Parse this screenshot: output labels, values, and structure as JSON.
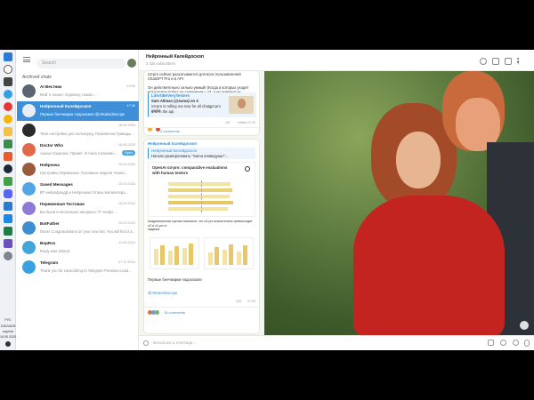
{
  "taskbar": {
    "lang": "РУС",
    "temp": "20&24&28",
    "weather": "отд/нов",
    "date": "16.06.2025"
  },
  "sidebar": {
    "search_placeholder": "Search",
    "archived_label": "Archived chats",
    "chats": [
      {
        "name": "AI Вестник",
        "preview": "Мой тг-канал: подписку, пожал...",
        "time": "19:50",
        "avatar_color": "#5b6470",
        "active": false
      },
      {
        "name": "Нейронный Калейдоскоп",
        "preview": "Первые бенчмарки подсказали @AIKaleidoscope",
        "time": "17:42",
        "avatar_color": "#e9eef5",
        "active": true
      },
      {
        "name": "",
        "preview": "Твоя настройка для полсекунд, Переменна Гравиды ...",
        "time": "16:05.2025",
        "avatar_color": "#2b2b2b",
        "active": false
      },
      {
        "name": "Doctor Who",
        "preview": "Ажоха Озерских: Привет. Я Анна Сенкевич...",
        "time": "16.05.2025",
        "avatar_color": "#e2684a",
        "active": false,
        "badge": "Open"
      },
      {
        "name": "Нейронка",
        "preview": "Настройка Перманэнх: Основные модели Чинни...",
        "time": "20.03.2025",
        "avatar_color": "#9a5a3e",
        "active": false
      },
      {
        "name": "Saved Messages",
        "preview": "ВТ-нейрофондД и Нейронная Этапы Кипалитера...",
        "time": "22.03.2025",
        "avatar_color": "#53a6e6",
        "active": false
      },
      {
        "name": "Переменная Тестовая",
        "preview": "Вы были в нескольких нисарных ТГ-нейро ...",
        "time": "15.03.2024",
        "avatar_color": "#8f7ad6",
        "active": false
      },
      {
        "name": "BotFather",
        "preview": "Done! Congratulations on your new bot. You will find it a...",
        "time": "19.03.2024",
        "avatar_color": "#3d8fd1",
        "active": false
      },
      {
        "name": "BopRss",
        "preview": "Reply was Visited",
        "time": "11.05.2024",
        "avatar_color": "#41a7da",
        "active": false
      },
      {
        "name": "Telegram",
        "preview": "Thank you for subscribing to Telegram Premium Lead...",
        "time": "07.12.2024",
        "avatar_color": "#3aa0e0",
        "active": false
      }
    ]
  },
  "header": {
    "title": "Нейронный Калейдоскоп",
    "subtitle": "2 325 subscribers"
  },
  "post1": {
    "lines": [
      "o3-pro сейчас раскатывается для всех пользователей",
      "ChatGPT Pro и в API",
      "",
      "Он действительно сильно умный! (Когда в которых уходят",
      "показатели побед на сравнении с o3, а не поверил их",
      "@AIKaleidoscope"
    ],
    "quote_title": "LilArtiBeVeryTesters",
    "quote_lines": [
      "Sam Altman (@sama) on X",
      "o3-pro is rolling out now for all chatgpt pro users",
      "and in the api."
    ],
    "views": "167",
    "time": "edited 17:22",
    "comments": "2 comments"
  },
  "post2": {
    "channel": "Нейронный Калейдоскоп",
    "reply_name": "Нейронный Калейдоскоп",
    "reply_text": "Начали разворачивать \"Sama ачиведушь!\"...",
    "chart_title": "OpenAI o3-pro: comparative evaluations",
    "chart_subtitle": "with human testers",
    "caption_lines": [
      "Академическая оценка показала, что o3-pro значительно превосходит o3 и o1-pro в",
      "задачах."
    ],
    "first_line": "Первые бенчмарки подсказали",
    "tag": "@AIKaleidoscope",
    "views": "245",
    "time": "17:53",
    "comments": "18 comments"
  },
  "composer": {
    "placeholder": "Broadcast a message..."
  }
}
